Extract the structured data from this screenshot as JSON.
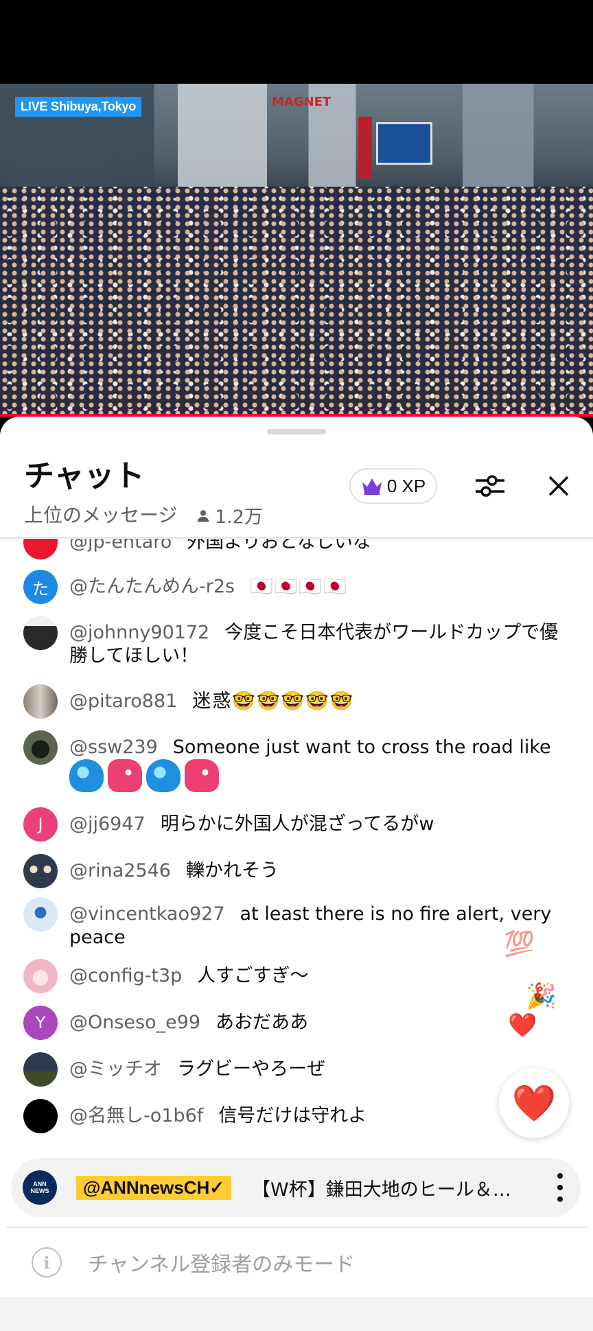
{
  "video": {
    "live_label": "LIVE Shibuya,Tokyo",
    "sign_text": "MAGNET"
  },
  "chat": {
    "title": "チャット",
    "filter_label": "上位のメッセージ",
    "viewer_count": "1.2万",
    "xp": "0 XP"
  },
  "messages": [
    {
      "author": "@jp-entaro",
      "text": "外国よりおとなしいな",
      "avatar_color": "#e8192c",
      "avatar_letter": ""
    },
    {
      "author": "@たんたんめん-r2s",
      "text": "🇯🇵🇯🇵🇯🇵🇯🇵",
      "avatar_color": "#1e88e5",
      "avatar_letter": "た"
    },
    {
      "author": "@johnny90172",
      "text": "今度こそ日本代表がワールドカップで優勝してほしい！",
      "avatar_color": "#d9d9d9",
      "avatar_letter": ""
    },
    {
      "author": "@pitaro881",
      "text": "迷惑🤓🤓🤓🤓🤓",
      "avatar_color": "#a09a92",
      "avatar_letter": ""
    },
    {
      "author": "@ssw239",
      "text": "Someone just want to cross the road like",
      "avatar_color": "#3c3f35",
      "avatar_letter": ""
    },
    {
      "author": "@jj6947",
      "text": "明らかに外国人が混ざってるがw",
      "avatar_color": "#ec407a",
      "avatar_letter": "J"
    },
    {
      "author": "@rina2546",
      "text": "轢かれそう",
      "avatar_color": "#2f3a4a",
      "avatar_letter": ""
    },
    {
      "author": "@vincentkao927",
      "text": "at least there is no fire alert, very peace",
      "avatar_color": "#dce9f5",
      "avatar_letter": ""
    },
    {
      "author": "@config-t3p",
      "text": "人すごすぎ〜",
      "avatar_color": "#f3b6c8",
      "avatar_letter": ""
    },
    {
      "author": "@Onseso_e99",
      "text": "あおだああ",
      "avatar_color": "#ab47bc",
      "avatar_letter": "Y"
    },
    {
      "author": "@ミッチオ",
      "text": "ラグビーやろーぜ",
      "avatar_color": "#2e3a52",
      "avatar_letter": ""
    },
    {
      "author": "@名無し-o1b6f",
      "text": "信号だけは守れよ",
      "avatar_color": "#000000",
      "avatar_letter": ""
    }
  ],
  "reactions": [
    "💯",
    "🎉",
    "❤️"
  ],
  "heart_button": "❤️",
  "pinned": {
    "channel_logo_top": "ANN",
    "channel_logo_bottom": "NEWS",
    "channel": "@ANNnewsCH✓",
    "text": "【W杯】鎌田大地のヒール＆スペシャル"
  },
  "info": {
    "text": "チャンネル登録者のみモード",
    "icon": "i"
  }
}
